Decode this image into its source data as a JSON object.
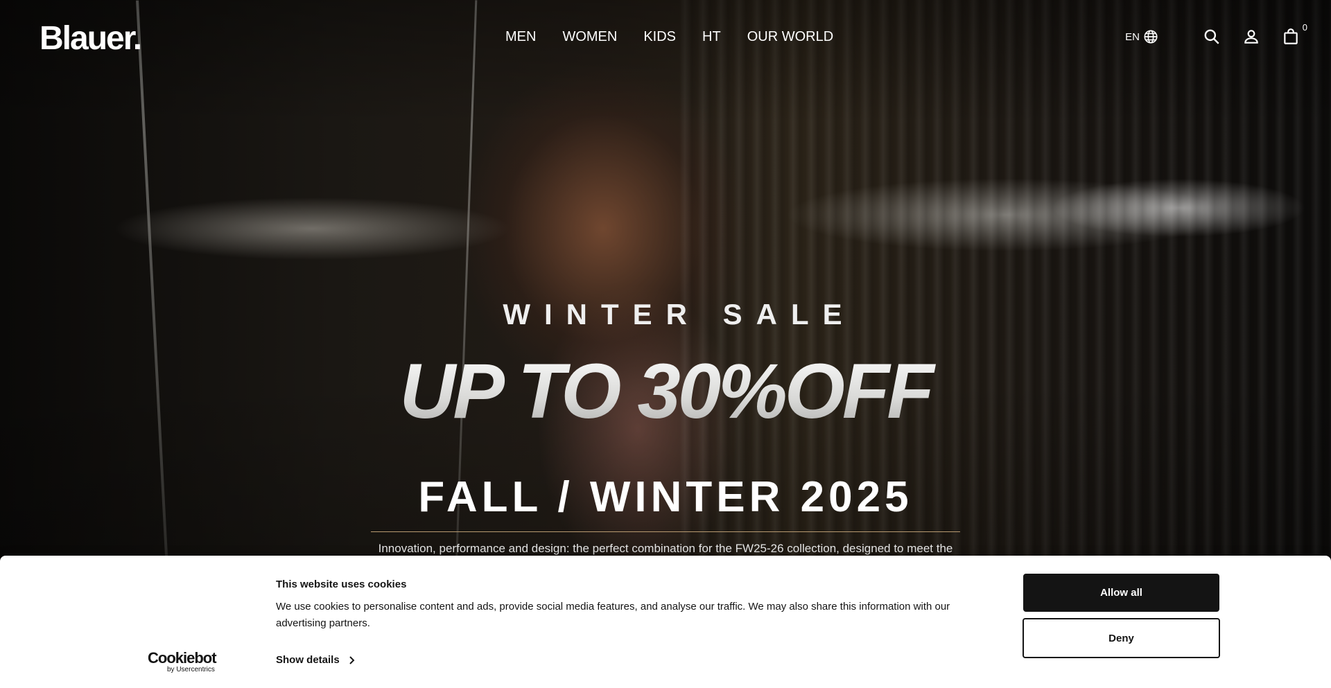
{
  "header": {
    "logo": "Blauer.",
    "nav": [
      {
        "label": "MEN"
      },
      {
        "label": "WOMEN"
      },
      {
        "label": "KIDS"
      },
      {
        "label": "HT"
      },
      {
        "label": "OUR WORLD"
      }
    ],
    "language": "EN",
    "cart_count": "0",
    "icons": [
      "globe-icon",
      "search-icon",
      "user-icon",
      "shopping-bag-icon"
    ]
  },
  "hero": {
    "eyebrow": "WINTER SALE",
    "headline": "UP TO 30%OFF",
    "season_title": "FALL / WINTER 2025",
    "description": "Innovation, performance and design: the perfect combination for the FW25-26 collection, designed to meet the"
  },
  "cookie_banner": {
    "brand_name": "Cookiebot",
    "brand_sub": "by Usercentrics",
    "title": "This website uses cookies",
    "text": "We use cookies to personalise content and ads, provide social media features, and analyse our traffic. We may also share this information with our advertising partners.",
    "show_details": "Show details",
    "allow_all": "Allow all",
    "deny": "Deny"
  }
}
